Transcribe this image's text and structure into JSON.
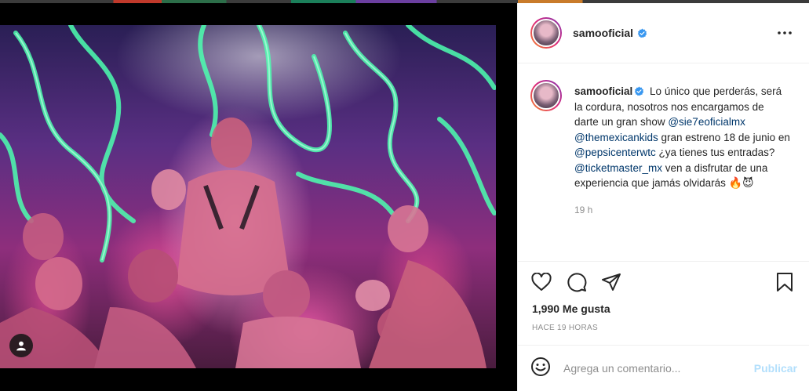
{
  "post": {
    "username": "samooficial",
    "caption_text_1": "Lo único que perderás, será la cordura, nosotros nos encargamos de darte un gran show",
    "mention_1": "@sie7eoficialmx",
    "mention_2": "@themexicankids",
    "caption_text_2": "gran estreno 18 de junio en",
    "mention_3": "@pepsicenterwtc",
    "caption_text_3": "¿ya tienes tus entradas?",
    "mention_4": "@ticketmaster_mx",
    "caption_text_4": "ven a disfrutar de una experiencia que jamás olvidarás",
    "emojis": "🔥😈",
    "time_ago": "19 h",
    "likes": "1,990 Me gusta",
    "timestamp": "HACE 19 HORAS"
  },
  "comment_box": {
    "placeholder": "Agrega un comentario...",
    "post_label": "Publicar"
  },
  "icons": {
    "verified": "verified-badge-icon",
    "more": "more-options-icon",
    "like": "heart-icon",
    "comment": "comment-icon",
    "share": "share-icon",
    "save": "bookmark-icon",
    "emoji": "emoji-icon",
    "user_tag": "user-tag-icon"
  },
  "colors": {
    "verified_blue": "#3897f0",
    "mention": "#00376b",
    "post_button": "#b2dffc",
    "neon_green": "#4dffb0"
  }
}
